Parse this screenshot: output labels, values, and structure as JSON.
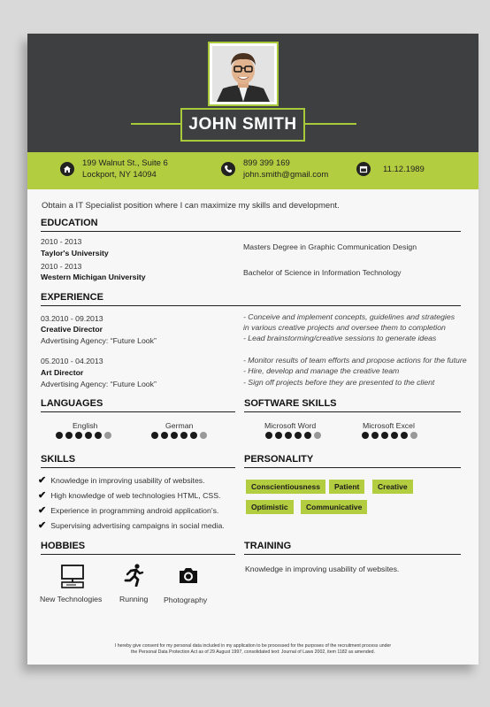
{
  "header": {
    "name": "JOHN SMITH"
  },
  "contact": {
    "address_line1": "199 Walnut St., Suite 6",
    "address_line2": "Lockport, NY 14094",
    "phone": "899 399 169",
    "email": "john.smith@gmail.com",
    "date": "11.12.1989"
  },
  "objective": "Obtain a IT Specialist position where I can maximize my skills and development.",
  "education": {
    "title": "EDUCATION",
    "items": [
      {
        "years": "2010 - 2013",
        "school": "Taylor's University",
        "degree": "Masters Degree in Graphic Communication Design"
      },
      {
        "years": "2010 - 2013",
        "school": "Western Michigan University",
        "degree": "Bachelor of Science in Information Technology"
      }
    ]
  },
  "experience": {
    "title": "EXPERIENCE",
    "items": [
      {
        "dates": "03.2010 - 09.2013",
        "role": "Creative Director",
        "agency": "Advertising Agency: “Future Look”",
        "duties": [
          "- Conceive and implement concepts, guidelines and strategies",
          "in various creative projects and oversee them to completion",
          "- Lead brainstorming/creative sessions to generate ideas"
        ]
      },
      {
        "dates": "05.2010 - 04.2013",
        "role": "Art  Director",
        "agency": "Advertising Agency: “Future Look”",
        "duties": [
          "- Monitor results of team efforts and propose actions for the future",
          "- Hire, develop and manage the creative team",
          "- Sign off projects before they are presented to the client"
        ]
      }
    ]
  },
  "languages": {
    "title": "LANGUAGES",
    "items": [
      {
        "name": "English",
        "level": 5,
        "max": 6
      },
      {
        "name": "German",
        "level": 5,
        "max": 6
      }
    ]
  },
  "software_skills": {
    "title": "SOFTWARE SKILLS",
    "items": [
      {
        "name": "Microsoft Word",
        "level": 5,
        "max": 6
      },
      {
        "name": "Microsoft Excel",
        "level": 5,
        "max": 6
      }
    ]
  },
  "skills": {
    "title": "SKILLS",
    "items": [
      "Knowledge in improving usability of websites.",
      "High knowledge of web technologies HTML, CSS.",
      "Experience in programming android application’s.",
      "Supervising advertising campaigns in social media."
    ]
  },
  "personality": {
    "title": "PERSONALITY",
    "tags": [
      "Conscientiousness",
      "Patient",
      "Creative",
      "Optimistic",
      "Communicative"
    ]
  },
  "hobbies": {
    "title": "HOBBIES",
    "items": [
      {
        "label": "New Technologies",
        "icon": "computer-icon"
      },
      {
        "label": "Running",
        "icon": "runner-icon"
      },
      {
        "label": "Photography",
        "icon": "camera-icon"
      }
    ]
  },
  "training": {
    "title": "TRAINING",
    "text": "Knowledge in improving usability of websites."
  },
  "footer": {
    "line1": "I hereby give consent for my personal data included in my application to be processed for the purposes of the recruitment process under",
    "line2": "the Personal Data Protection Act as of 29 August 1997, consolidated text: Journal of Laws 2002, item 1182 as amended."
  },
  "colors": {
    "accent": "#b2cd3f",
    "header_bg": "#3e3f41"
  }
}
